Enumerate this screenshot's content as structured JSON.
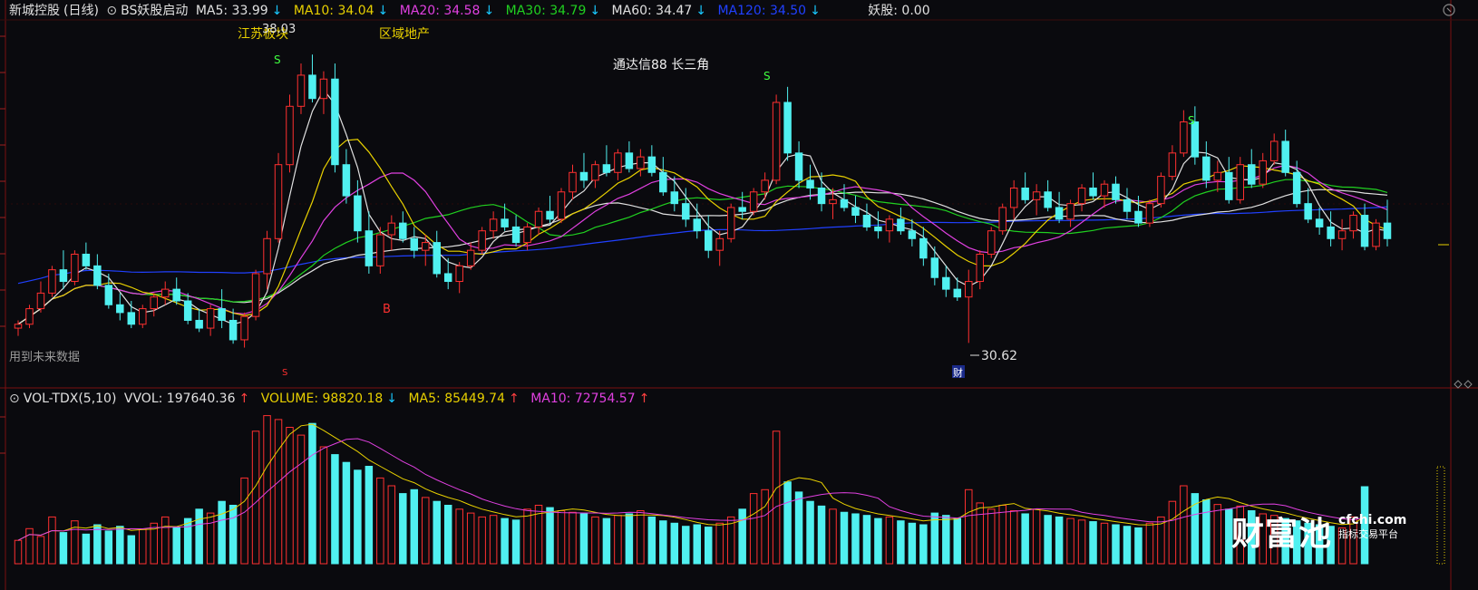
{
  "header": {
    "stock_name": "新城控股",
    "period": "(日线)",
    "indicator_name": "BS妖股启动",
    "ma5": {
      "label": "MA5: 33.99",
      "arrow": "↓",
      "color": "#e0e0e0"
    },
    "ma10": {
      "label": "MA10: 34.04",
      "arrow": "↓",
      "color": "#e8d000"
    },
    "ma20": {
      "label": "MA20: 34.58",
      "arrow": "↓",
      "color": "#e040e0"
    },
    "ma30": {
      "label": "MA30: 34.79",
      "arrow": "↓",
      "color": "#20d020"
    },
    "ma60": {
      "label": "MA60: 34.47",
      "arrow": "↓",
      "color": "#e0e0e0"
    },
    "ma120": {
      "label": "MA120: 34.50",
      "arrow": "↓",
      "color": "#2040ff"
    },
    "yaogu": "妖股: 0.00"
  },
  "annotations": {
    "high_price": "38.03",
    "low_price": "30.62",
    "label_jiangsu": "江苏板块",
    "label_quyu": "区域地产",
    "label_tdx": "通达信88 长三角",
    "future_data": "用到未来数据",
    "buy_marker": "B",
    "sell_marker": "S",
    "cai_marker": "财"
  },
  "volume_header": {
    "name": "VOL-TDX(5,10)",
    "vvol": "VVOL: 197640.36",
    "vvol_arrow": "↑",
    "volume": "VOLUME: 98820.18",
    "volume_arrow": "↓",
    "ma5": "MA5: 85449.74",
    "ma5_arrow": "↑",
    "ma10": "MA10: 72754.57",
    "ma10_arrow": "↑"
  },
  "watermark": {
    "brand": "财富池",
    "domain": "cfchi.com",
    "tagline": "指标交易平台"
  },
  "colors": {
    "up": "#ff3030",
    "down": "#50f0f0",
    "ma5": "#e0e0e0",
    "ma10": "#e8d000",
    "ma20": "#e040e0",
    "ma30": "#20d020",
    "ma60": "#e0e0e0",
    "ma120": "#2040ff",
    "grid": "#7a1010"
  },
  "chart_data": {
    "type": "candlestick",
    "price_range": [
      30.0,
      38.5
    ],
    "candles": [
      [
        31.0,
        31.2,
        30.8,
        31.1
      ],
      [
        31.1,
        31.6,
        31.0,
        31.5
      ],
      [
        31.5,
        32.2,
        31.4,
        31.9
      ],
      [
        31.9,
        32.6,
        31.8,
        32.5
      ],
      [
        32.5,
        33.0,
        32.0,
        32.2
      ],
      [
        32.2,
        33.0,
        32.1,
        32.9
      ],
      [
        32.9,
        33.2,
        32.5,
        32.6
      ],
      [
        32.6,
        32.9,
        32.0,
        32.1
      ],
      [
        32.1,
        32.4,
        31.5,
        31.6
      ],
      [
        31.6,
        31.9,
        31.2,
        31.4
      ],
      [
        31.4,
        31.7,
        31.0,
        31.1
      ],
      [
        31.1,
        31.6,
        31.0,
        31.5
      ],
      [
        31.5,
        31.9,
        31.3,
        31.8
      ],
      [
        31.8,
        32.2,
        31.6,
        32.0
      ],
      [
        32.0,
        32.3,
        31.6,
        31.7
      ],
      [
        31.7,
        31.9,
        31.1,
        31.2
      ],
      [
        31.2,
        31.5,
        30.9,
        31.0
      ],
      [
        31.0,
        31.6,
        30.8,
        31.5
      ],
      [
        31.5,
        32.0,
        31.0,
        31.2
      ],
      [
        31.2,
        31.5,
        30.6,
        30.7
      ],
      [
        30.7,
        31.4,
        30.5,
        31.3
      ],
      [
        31.3,
        32.5,
        31.2,
        32.4
      ],
      [
        32.4,
        33.5,
        32.0,
        33.3
      ],
      [
        33.3,
        35.5,
        33.2,
        35.2
      ],
      [
        35.2,
        37.0,
        35.0,
        36.7
      ],
      [
        36.7,
        37.8,
        36.5,
        37.5
      ],
      [
        37.5,
        38.03,
        36.8,
        36.9
      ],
      [
        36.9,
        37.6,
        36.5,
        37.4
      ],
      [
        37.4,
        37.8,
        35.0,
        35.2
      ],
      [
        35.2,
        35.6,
        34.2,
        34.4
      ],
      [
        34.4,
        34.8,
        33.2,
        33.5
      ],
      [
        33.5,
        34.0,
        32.4,
        32.6
      ],
      [
        32.6,
        33.6,
        32.4,
        33.4
      ],
      [
        33.4,
        33.9,
        33.0,
        33.7
      ],
      [
        33.7,
        34.0,
        33.2,
        33.3
      ],
      [
        33.3,
        33.6,
        32.8,
        33.0
      ],
      [
        33.0,
        33.4,
        32.6,
        33.2
      ],
      [
        33.2,
        33.5,
        32.3,
        32.4
      ],
      [
        32.4,
        32.8,
        32.0,
        32.2
      ],
      [
        32.2,
        32.7,
        31.9,
        32.6
      ],
      [
        32.6,
        33.2,
        32.5,
        33.0
      ],
      [
        33.0,
        33.6,
        32.9,
        33.5
      ],
      [
        33.5,
        34.0,
        33.3,
        33.8
      ],
      [
        33.8,
        34.2,
        33.5,
        33.6
      ],
      [
        33.6,
        33.9,
        33.1,
        33.2
      ],
      [
        33.2,
        33.7,
        33.0,
        33.6
      ],
      [
        33.6,
        34.1,
        33.4,
        34.0
      ],
      [
        34.0,
        34.4,
        33.7,
        33.8
      ],
      [
        33.8,
        34.6,
        33.7,
        34.5
      ],
      [
        34.5,
        35.2,
        34.3,
        35.0
      ],
      [
        35.0,
        35.5,
        34.6,
        34.8
      ],
      [
        34.8,
        35.3,
        34.6,
        35.2
      ],
      [
        35.2,
        35.7,
        34.9,
        35.0
      ],
      [
        35.0,
        35.6,
        34.8,
        35.5
      ],
      [
        35.5,
        35.8,
        35.0,
        35.1
      ],
      [
        35.1,
        35.6,
        34.9,
        35.4
      ],
      [
        35.4,
        35.7,
        34.9,
        35.0
      ],
      [
        35.0,
        35.4,
        34.4,
        34.5
      ],
      [
        34.5,
        34.9,
        34.0,
        34.2
      ],
      [
        34.2,
        34.6,
        33.6,
        33.8
      ],
      [
        33.8,
        34.2,
        33.3,
        33.5
      ],
      [
        33.5,
        33.9,
        32.8,
        33.0
      ],
      [
        33.0,
        33.5,
        32.6,
        33.3
      ],
      [
        33.3,
        34.2,
        33.2,
        34.1
      ],
      [
        34.1,
        34.5,
        33.8,
        34.0
      ],
      [
        34.0,
        34.6,
        33.9,
        34.5
      ],
      [
        34.5,
        35.0,
        34.3,
        34.8
      ],
      [
        34.8,
        37.0,
        34.7,
        36.8
      ],
      [
        36.8,
        37.2,
        35.3,
        35.5
      ],
      [
        35.5,
        35.8,
        34.6,
        34.8
      ],
      [
        34.8,
        35.2,
        34.3,
        34.6
      ],
      [
        34.6,
        35.0,
        34.0,
        34.2
      ],
      [
        34.2,
        34.6,
        33.8,
        34.3
      ],
      [
        34.3,
        34.7,
        34.0,
        34.1
      ],
      [
        34.1,
        34.4,
        33.7,
        33.9
      ],
      [
        33.9,
        34.2,
        33.5,
        33.6
      ],
      [
        33.6,
        34.0,
        33.3,
        33.5
      ],
      [
        33.5,
        33.9,
        33.2,
        33.8
      ],
      [
        33.8,
        34.1,
        33.4,
        33.5
      ],
      [
        33.5,
        33.8,
        33.1,
        33.3
      ],
      [
        33.3,
        33.6,
        32.6,
        32.8
      ],
      [
        32.8,
        33.1,
        32.1,
        32.3
      ],
      [
        32.3,
        32.6,
        31.8,
        32.0
      ],
      [
        32.0,
        32.3,
        31.7,
        31.8
      ],
      [
        31.8,
        32.5,
        30.62,
        32.2
      ],
      [
        32.2,
        33.0,
        32.0,
        32.9
      ],
      [
        32.9,
        33.6,
        32.8,
        33.5
      ],
      [
        33.5,
        34.2,
        33.4,
        34.1
      ],
      [
        34.1,
        34.8,
        33.8,
        34.6
      ],
      [
        34.6,
        35.0,
        34.2,
        34.3
      ],
      [
        34.3,
        34.7,
        33.9,
        34.5
      ],
      [
        34.5,
        34.8,
        34.0,
        34.1
      ],
      [
        34.1,
        34.5,
        33.7,
        33.8
      ],
      [
        33.8,
        34.3,
        33.6,
        34.2
      ],
      [
        34.2,
        34.7,
        34.0,
        34.6
      ],
      [
        34.6,
        35.0,
        34.3,
        34.4
      ],
      [
        34.4,
        34.8,
        34.1,
        34.7
      ],
      [
        34.7,
        34.9,
        34.2,
        34.3
      ],
      [
        34.3,
        34.6,
        33.8,
        34.0
      ],
      [
        34.0,
        34.4,
        33.6,
        33.7
      ],
      [
        33.7,
        34.3,
        33.6,
        34.2
      ],
      [
        34.2,
        35.0,
        34.1,
        34.9
      ],
      [
        34.9,
        35.7,
        34.8,
        35.5
      ],
      [
        35.5,
        36.6,
        35.4,
        36.3
      ],
      [
        36.3,
        36.7,
        35.2,
        35.4
      ],
      [
        35.4,
        35.8,
        34.6,
        34.8
      ],
      [
        34.8,
        35.3,
        34.5,
        35.0
      ],
      [
        35.0,
        35.4,
        34.2,
        34.3
      ],
      [
        34.3,
        35.4,
        34.2,
        35.2
      ],
      [
        35.2,
        35.6,
        34.6,
        34.7
      ],
      [
        34.7,
        35.5,
        34.6,
        35.3
      ],
      [
        35.3,
        36.0,
        35.2,
        35.8
      ],
      [
        35.8,
        36.1,
        34.9,
        35.0
      ],
      [
        35.0,
        35.3,
        34.1,
        34.2
      ],
      [
        34.2,
        34.6,
        33.7,
        33.8
      ],
      [
        33.8,
        34.1,
        33.4,
        33.6
      ],
      [
        33.6,
        34.0,
        33.1,
        33.3
      ],
      [
        33.3,
        33.8,
        33.0,
        33.5
      ],
      [
        33.5,
        34.0,
        33.3,
        33.9
      ],
      [
        33.9,
        34.2,
        33.0,
        33.1
      ],
      [
        33.1,
        33.8,
        33.0,
        33.7
      ],
      [
        33.7,
        34.3,
        33.1,
        33.3
      ]
    ],
    "volume_range": [
      0,
      200000
    ],
    "volumes": [
      30000,
      45000,
      35000,
      60000,
      40000,
      55000,
      38000,
      50000,
      42000,
      48000,
      36000,
      44000,
      52000,
      60000,
      46000,
      58000,
      70000,
      65000,
      80000,
      75000,
      110000,
      170000,
      190000,
      185000,
      175000,
      165000,
      180000,
      150000,
      140000,
      130000,
      120000,
      125000,
      110000,
      100000,
      90000,
      95000,
      85000,
      80000,
      75000,
      70000,
      65000,
      60000,
      62000,
      58000,
      56000,
      70000,
      75000,
      72000,
      68000,
      66000,
      64000,
      60000,
      58000,
      62000,
      64000,
      68000,
      60000,
      55000,
      52000,
      48000,
      50000,
      47000,
      52000,
      60000,
      70000,
      90000,
      95000,
      170000,
      105000,
      92000,
      80000,
      74000,
      70000,
      66000,
      64000,
      62000,
      58000,
      60000,
      55000,
      52000,
      50000,
      65000,
      62000,
      58000,
      95000,
      78000,
      70000,
      75000,
      68000,
      64000,
      70000,
      62000,
      60000,
      58000,
      56000,
      54000,
      52000,
      50000,
      48000,
      46000,
      52000,
      60000,
      80000,
      100000,
      90000,
      82000,
      76000,
      70000,
      74000,
      68000,
      64000,
      62000,
      58000,
      55000,
      52000,
      50000,
      48000,
      46000,
      60000,
      98820
    ]
  }
}
